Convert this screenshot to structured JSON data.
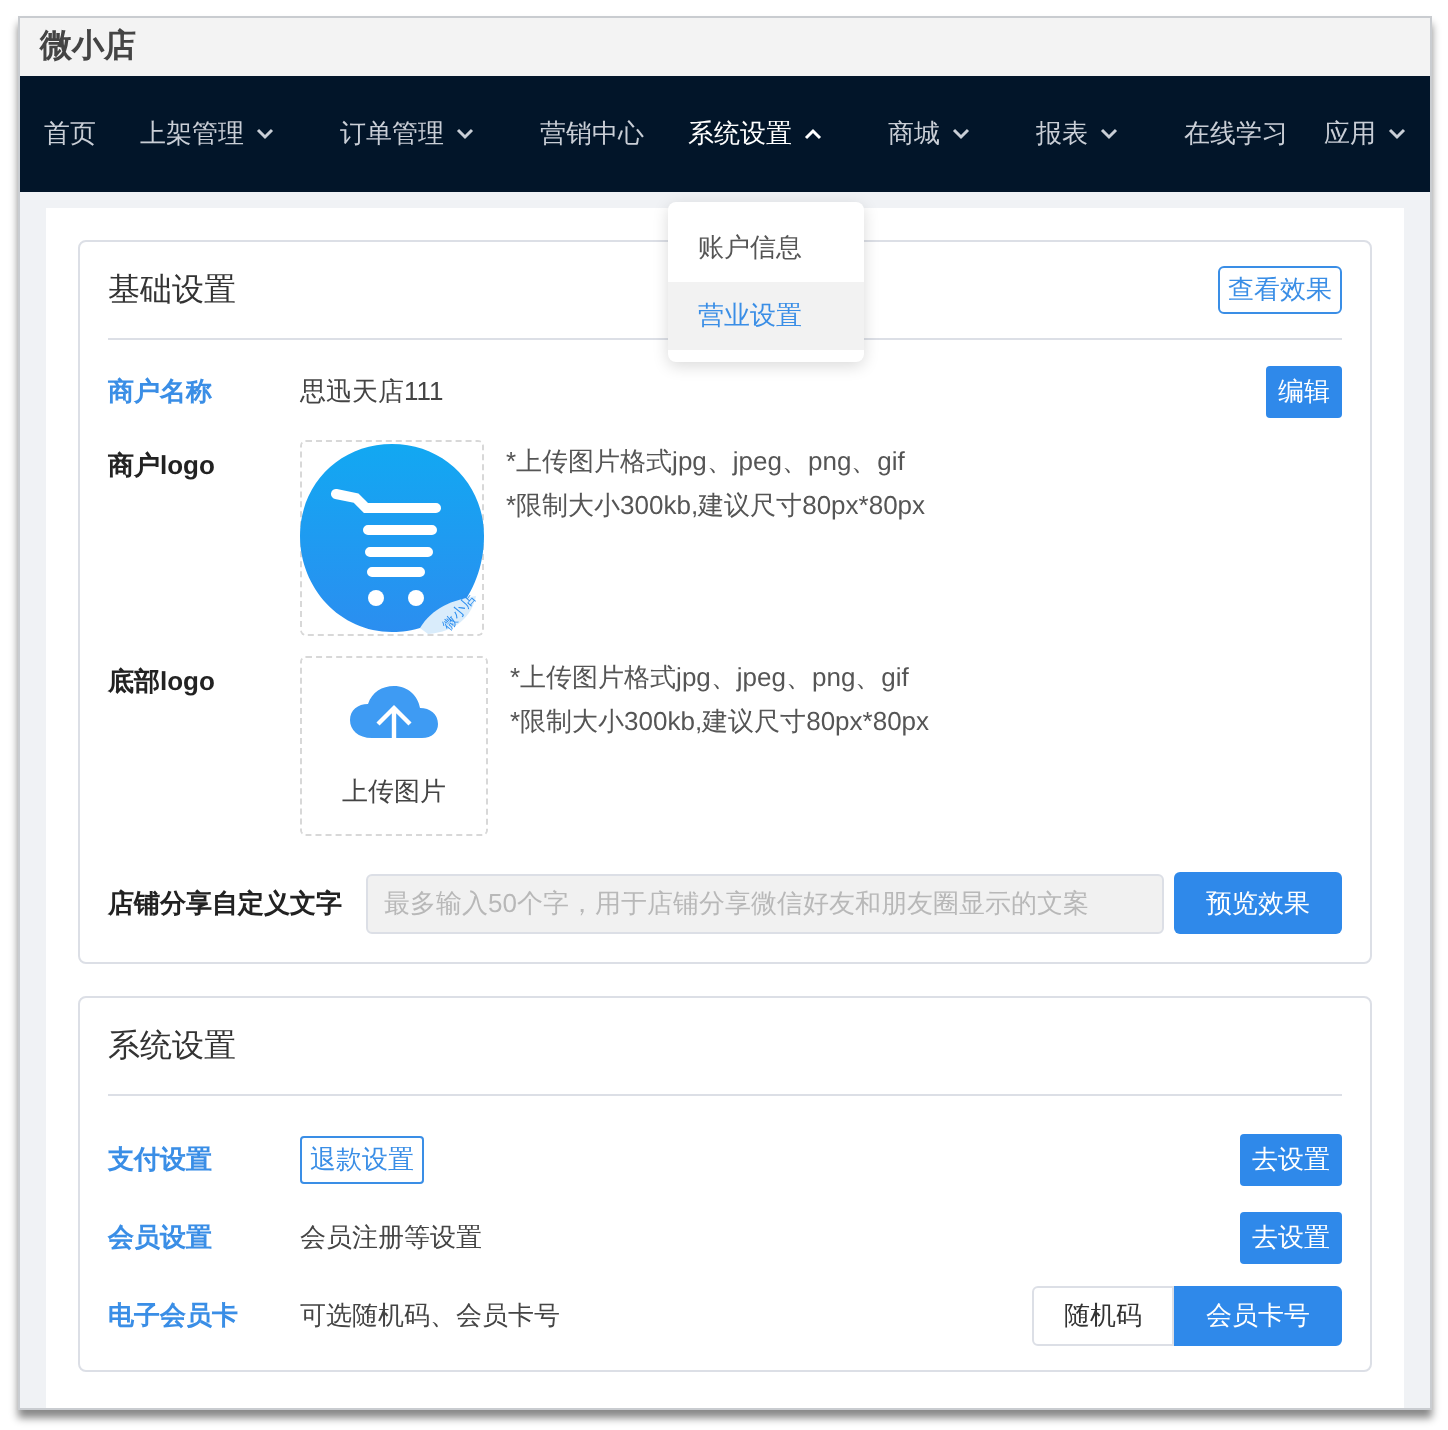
{
  "window": {
    "title": "微小店"
  },
  "nav": [
    {
      "label": "首页",
      "has_menu": false,
      "expanded": false
    },
    {
      "label": "上架管理",
      "has_menu": true,
      "expanded": false
    },
    {
      "label": "订单管理",
      "has_menu": true,
      "expanded": false
    },
    {
      "label": "营销中心",
      "has_menu": false,
      "expanded": false
    },
    {
      "label": "系统设置",
      "has_menu": true,
      "expanded": true
    },
    {
      "label": "商城",
      "has_menu": true,
      "expanded": false
    },
    {
      "label": "报表",
      "has_menu": true,
      "expanded": false
    },
    {
      "label": "在线学习",
      "has_menu": false,
      "expanded": false
    },
    {
      "label": "应用",
      "has_menu": true,
      "expanded": false
    }
  ],
  "dropdown": [
    {
      "label": "账户信息",
      "selected": false
    },
    {
      "label": "营业设置",
      "selected": true
    }
  ],
  "basic": {
    "title": "基础设置",
    "view_button": "查看效果",
    "name_row": {
      "label": "商户名称",
      "value": "思迅天店111",
      "button": "编辑"
    },
    "logo_rows": [
      {
        "kind": "image",
        "label": "商户logo",
        "badge": "微小店",
        "hints": [
          "*上传图片格式jpg、jpeg、png、gif",
          "*限制大小300kb,建议尺寸80px*80px"
        ]
      },
      {
        "kind": "upload",
        "label": "底部logo",
        "upload_text": "上传图片",
        "hints": [
          "*上传图片格式jpg、jpeg、png、gif",
          "*限制大小300kb,建议尺寸80px*80px"
        ]
      }
    ],
    "share": {
      "label": "店铺分享自定义文字",
      "placeholder": "最多输入50个字，用于店铺分享微信好友和朋友圈显示的文案",
      "button": "预览效果"
    }
  },
  "system": {
    "title": "系统设置",
    "rows": [
      {
        "kind": "outline",
        "label": "支付设置",
        "tag": "退款设置",
        "button": "去设置"
      },
      {
        "kind": "text",
        "label": "会员设置",
        "value": "会员注册等设置",
        "button": "去设置"
      },
      {
        "kind": "toggle",
        "label": "电子会员卡",
        "value": "可选随机码、会员卡号",
        "options": [
          {
            "label": "随机码",
            "selected": false
          },
          {
            "label": "会员卡号",
            "selected": true
          }
        ]
      }
    ]
  }
}
